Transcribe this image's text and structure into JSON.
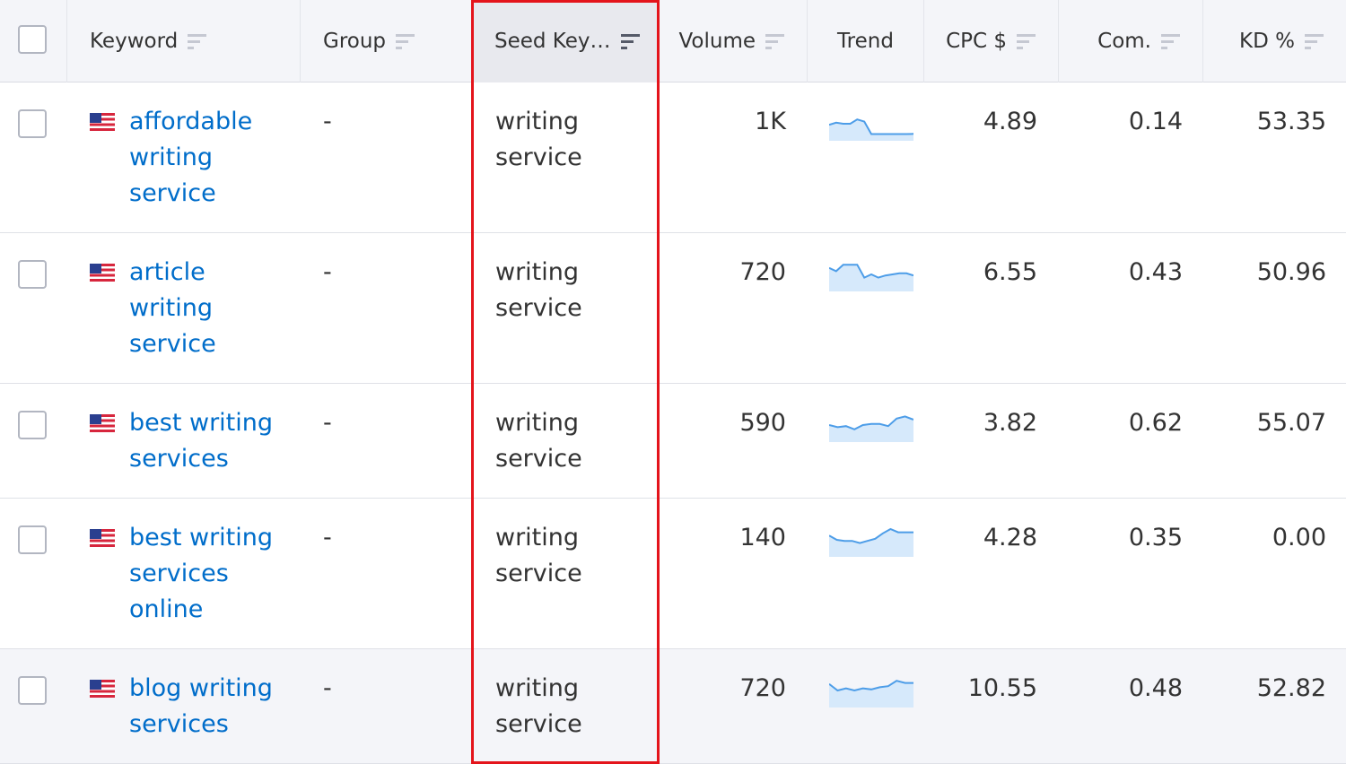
{
  "columns": {
    "keyword": "Keyword",
    "group": "Group",
    "seed_keyword": "Seed Key…",
    "volume": "Volume",
    "trend": "Trend",
    "cpc": "CPC $",
    "com": "Com.",
    "kd": "KD %"
  },
  "rows": [
    {
      "keyword": "affordable writing service",
      "group": "-",
      "seed": "writing service",
      "volume": "1K",
      "cpc": "4.89",
      "com": "0.14",
      "kd": "53.35",
      "trend": [
        0.55,
        0.45,
        0.5,
        0.5,
        0.3,
        0.4,
        0.98,
        0.98,
        0.98,
        0.98,
        0.98,
        0.98,
        0.97
      ]
    },
    {
      "keyword": "article writing service",
      "group": "-",
      "seed": "writing service",
      "volume": "720",
      "cpc": "6.55",
      "com": "0.43",
      "kd": "50.96",
      "trend": [
        0.2,
        0.35,
        0.05,
        0.05,
        0.05,
        0.65,
        0.5,
        0.65,
        0.55,
        0.5,
        0.45,
        0.45,
        0.55
      ]
    },
    {
      "keyword": "best writing services",
      "group": "-",
      "seed": "writing service",
      "volume": "590",
      "cpc": "3.82",
      "com": "0.62",
      "kd": "55.07",
      "trend": [
        0.5,
        0.6,
        0.55,
        0.7,
        0.5,
        0.45,
        0.45,
        0.55,
        0.2,
        0.1,
        0.25
      ]
    },
    {
      "keyword": "best writing services online",
      "group": "-",
      "seed": "writing service",
      "volume": "140",
      "cpc": "4.28",
      "com": "0.35",
      "kd": "0.00",
      "trend": [
        0.3,
        0.5,
        0.55,
        0.55,
        0.65,
        0.55,
        0.45,
        0.2,
        0.0,
        0.15,
        0.15,
        0.15
      ]
    },
    {
      "keyword": "blog writing services",
      "group": "-",
      "seed": "writing service",
      "volume": "720",
      "cpc": "10.55",
      "com": "0.48",
      "kd": "52.82",
      "trend": [
        0.2,
        0.5,
        0.4,
        0.5,
        0.4,
        0.45,
        0.35,
        0.3,
        0.05,
        0.15,
        0.15
      ]
    }
  ],
  "colors": {
    "link": "#006dca",
    "sparkline_stroke": "#4d9de8",
    "sparkline_fill": "#d6e9fb",
    "highlight_border": "#e4141b"
  },
  "icons": {
    "flag": "us-flag-icon",
    "sort": "sort-lines-icon",
    "checkbox": "checkbox-icon"
  }
}
